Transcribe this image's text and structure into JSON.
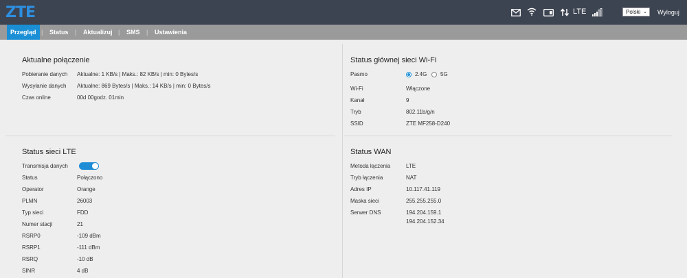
{
  "header": {
    "logo": "ZTE",
    "network_type": "LTE",
    "language": "Polski",
    "logout": "Wyloguj",
    "icons": [
      "envelope-icon",
      "wifi-icon",
      "sim-card-icon",
      "data-transfer-icon",
      "signal-strength-icon"
    ]
  },
  "nav": {
    "items": [
      "Przegląd",
      "Status",
      "Aktualizuj",
      "SMS",
      "Ustawienia"
    ],
    "active": "Przegląd",
    "separator": "|"
  },
  "connection": {
    "title": "Aktualne połączenie",
    "rows": [
      {
        "label": "Pobieranie danych",
        "value": "Aktualne: 1 KB/s | Maks.: 82 KB/s | min: 0 Bytes/s"
      },
      {
        "label": "Wysyłanie danych",
        "value": "Aktualne: 869 Bytes/s | Maks.: 14 KB/s | min: 0 Bytes/s"
      },
      {
        "label": "Czas online",
        "value": "00d 00godz. 01min"
      }
    ]
  },
  "wifi": {
    "title": "Status głównej sieci Wi-Fi",
    "band_label": "Pasmo",
    "band_options": [
      "2.4G",
      "5G"
    ],
    "band_selected": "2.4G",
    "rows": [
      {
        "label": "Wi-Fi",
        "value": "Włączone"
      },
      {
        "label": "Kanał",
        "value": "9"
      },
      {
        "label": "Tryb",
        "value": "802.11b/g/n"
      },
      {
        "label": "SSID",
        "value": "ZTE MF258-D240"
      }
    ]
  },
  "lte": {
    "title": "Status sieci LTE",
    "transmission_label": "Transmisja danych",
    "transmission_on": true,
    "rows": [
      {
        "label": "Status",
        "value": "Połączono"
      },
      {
        "label": "Operator",
        "value": "Orange"
      },
      {
        "label": "PLMN",
        "value": "26003"
      },
      {
        "label": "Typ sieci",
        "value": "FDD"
      },
      {
        "label": "Numer stacji",
        "value": "21"
      },
      {
        "label": "RSRP0",
        "value": "-109 dBm"
      },
      {
        "label": "RSRP1",
        "value": "-111 dBm"
      },
      {
        "label": "RSRQ",
        "value": "-10 dB"
      },
      {
        "label": "SINR",
        "value": "4 dB"
      }
    ]
  },
  "wan": {
    "title": "Status WAN",
    "rows": [
      {
        "label": "Metoda łączenia",
        "value": "LTE"
      },
      {
        "label": "Tryb łączenia",
        "value": "NAT"
      },
      {
        "label": "Adres IP",
        "value": "10.117.41.119"
      },
      {
        "label": "Maska sieci",
        "value": "255.255.255.0"
      },
      {
        "label": "Serwer DNS",
        "value": "194.204.159.1"
      }
    ],
    "dns_secondary": "194.204.152.34"
  },
  "colors": {
    "topbar": "#3d4451",
    "nav": "#9a9a9a",
    "accent": "#1a8fd6",
    "background": "#eeeeee"
  }
}
